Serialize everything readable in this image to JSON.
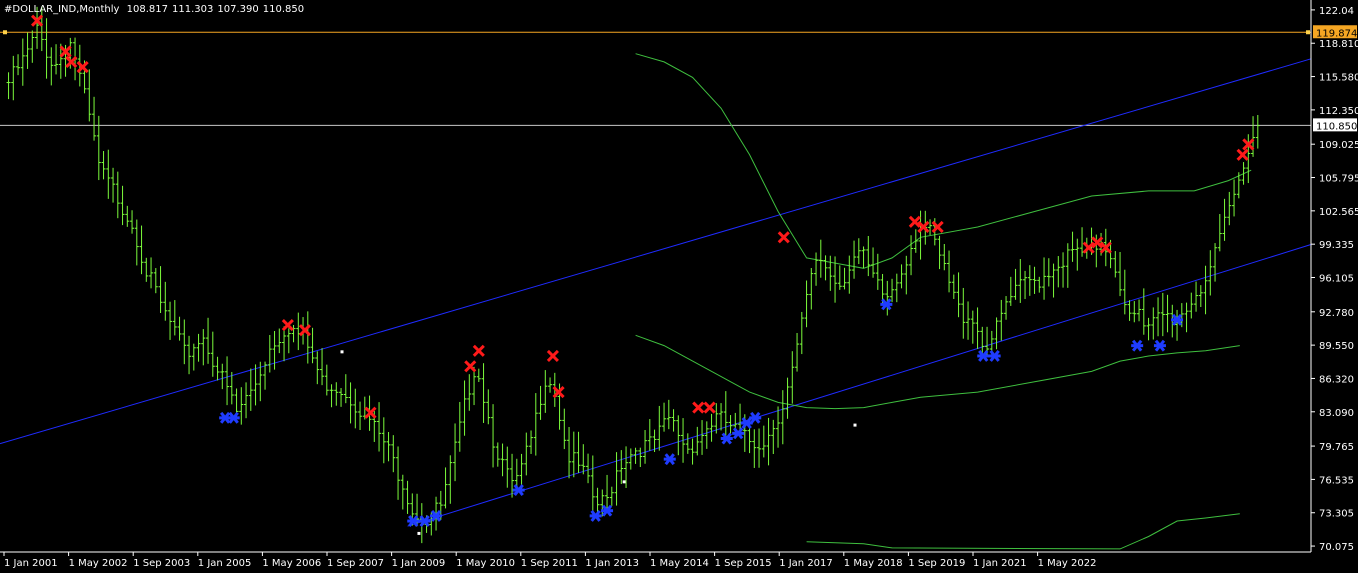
{
  "header": {
    "symbol_timeframe": "#DOLLAR_IND,Monthly",
    "open": "108.817",
    "high": "111.303",
    "low": "107.390",
    "close": "110.850"
  },
  "colors": {
    "background": "#000000",
    "bars": "#7cfc3c",
    "channel": "#1f2bff",
    "envelope": "#3fbf3f",
    "sell_marker": "#ff1a1a",
    "buy_marker": "#1f3cff",
    "axis_text": "#ffffff",
    "hline_max": "#f5a623",
    "hline_price": "#c8c8c8"
  },
  "chart_data": {
    "type": "bar",
    "title": "#DOLLAR_IND,Monthly",
    "y_ticks": [
      "122.04",
      "118.810",
      "115.580",
      "112.350",
      "109.025",
      "105.795",
      "102.565",
      "99.335",
      "96.105",
      "92.780",
      "89.550",
      "86.320",
      "83.090",
      "79.765",
      "76.535",
      "73.305",
      "70.075"
    ],
    "x_ticks": [
      "1 Jan 2001",
      "1 May 2002",
      "1 Sep 2003",
      "1 Jan 2005",
      "1 May 2006",
      "1 Sep 2007",
      "1 Jan 2009",
      "1 May 2010",
      "1 Sep 2011",
      "1 Jan 2013",
      "1 May 2014",
      "1 Sep 2015",
      "1 Jan 2017",
      "1 May 2018",
      "1 Sep 2019",
      "1 Jan 2021",
      "1 May 2022"
    ],
    "ylim": [
      69.5,
      123.0
    ],
    "xlim": [
      2000.85,
      2023.85
    ],
    "price_lines": [
      {
        "label": "119.874",
        "value": 119.874,
        "role": "max"
      },
      {
        "label": "110.850",
        "value": 110.85,
        "role": "current"
      }
    ],
    "monthly_close_anchors": [
      [
        2001.0,
        115.0
      ],
      [
        2001.3,
        117.5
      ],
      [
        2001.5,
        120.0
      ],
      [
        2001.8,
        116.5
      ],
      [
        2002.1,
        119.0
      ],
      [
        2002.4,
        112.0
      ],
      [
        2002.6,
        106.5
      ],
      [
        2002.9,
        104.0
      ],
      [
        2003.2,
        101.0
      ],
      [
        2003.4,
        97.0
      ],
      [
        2003.7,
        93.0
      ],
      [
        2003.9,
        91.0
      ],
      [
        2004.1,
        88.5
      ],
      [
        2004.4,
        90.5
      ],
      [
        2004.6,
        88.0
      ],
      [
        2004.9,
        84.5
      ],
      [
        2005.0,
        83.0
      ],
      [
        2005.3,
        85.5
      ],
      [
        2005.6,
        89.5
      ],
      [
        2005.9,
        91.5
      ],
      [
        2006.2,
        90.0
      ],
      [
        2006.5,
        86.0
      ],
      [
        2006.8,
        85.5
      ],
      [
        2007.0,
        84.5
      ],
      [
        2007.3,
        82.5
      ],
      [
        2007.6,
        80.0
      ],
      [
        2007.9,
        76.5
      ],
      [
        2008.1,
        73.5
      ],
      [
        2008.3,
        72.5
      ],
      [
        2008.6,
        74.0
      ],
      [
        2008.9,
        81.0
      ],
      [
        2009.1,
        86.0
      ],
      [
        2009.2,
        88.0
      ],
      [
        2009.5,
        80.5
      ],
      [
        2009.8,
        76.0
      ],
      [
        2009.95,
        76.5
      ],
      [
        2010.2,
        81.0
      ],
      [
        2010.4,
        86.5
      ],
      [
        2010.55,
        86.0
      ],
      [
        2010.8,
        79.0
      ],
      [
        2011.1,
        77.0
      ],
      [
        2011.3,
        74.0
      ],
      [
        2011.5,
        74.5
      ],
      [
        2011.7,
        78.0
      ],
      [
        2012.0,
        79.5
      ],
      [
        2012.3,
        80.0
      ],
      [
        2012.6,
        82.5
      ],
      [
        2012.9,
        79.5
      ],
      [
        2013.1,
        80.5
      ],
      [
        2013.4,
        82.5
      ],
      [
        2013.6,
        82.0
      ],
      [
        2013.9,
        80.5
      ],
      [
        2014.1,
        80.0
      ],
      [
        2014.3,
        80.5
      ],
      [
        2014.6,
        84.0
      ],
      [
        2014.8,
        88.0
      ],
      [
        2015.0,
        94.0
      ],
      [
        2015.2,
        98.5
      ],
      [
        2015.4,
        96.5
      ],
      [
        2015.6,
        95.5
      ],
      [
        2015.8,
        98.0
      ],
      [
        2015.95,
        98.5
      ],
      [
        2016.2,
        95.5
      ],
      [
        2016.4,
        94.0
      ],
      [
        2016.6,
        96.0
      ],
      [
        2016.85,
        99.5
      ],
      [
        2017.0,
        101.5
      ],
      [
        2017.2,
        100.0
      ],
      [
        2017.5,
        95.5
      ],
      [
        2017.7,
        92.5
      ],
      [
        2017.9,
        92.5
      ],
      [
        2018.1,
        89.5
      ],
      [
        2018.3,
        90.5
      ],
      [
        2018.5,
        93.5
      ],
      [
        2018.8,
        95.5
      ],
      [
        2019.1,
        96.0
      ],
      [
        2019.4,
        97.5
      ],
      [
        2019.7,
        98.5
      ],
      [
        2019.9,
        98.5
      ],
      [
        2020.1,
        98.5
      ],
      [
        2020.25,
        99.0
      ],
      [
        2020.4,
        97.5
      ],
      [
        2020.6,
        93.5
      ],
      [
        2020.8,
        93.0
      ],
      [
        2020.95,
        90.5
      ],
      [
        2021.2,
        92.5
      ],
      [
        2021.5,
        92.0
      ],
      [
        2021.7,
        93.5
      ],
      [
        2021.95,
        95.5
      ],
      [
        2022.2,
        98.5
      ],
      [
        2022.4,
        102.5
      ],
      [
        2022.6,
        105.5
      ],
      [
        2022.75,
        109.0
      ],
      [
        2022.9,
        110.85
      ]
    ],
    "channel_upper": [
      [
        2000.85,
        80.0
      ],
      [
        2023.85,
        117.3
      ]
    ],
    "channel_lower": [
      [
        2008.0,
        72.0
      ],
      [
        2023.85,
        99.3
      ]
    ],
    "envelope_upper": [
      [
        2012.0,
        117.8
      ],
      [
        2012.5,
        117.0
      ],
      [
        2013.0,
        115.5
      ],
      [
        2013.5,
        112.5
      ],
      [
        2014.0,
        108.0
      ],
      [
        2014.5,
        102.5
      ],
      [
        2015.0,
        98.0
      ],
      [
        2015.5,
        97.5
      ],
      [
        2016.0,
        97.0
      ],
      [
        2016.5,
        98.0
      ],
      [
        2017.0,
        100.0
      ],
      [
        2018.0,
        101.0
      ],
      [
        2019.0,
        102.5
      ],
      [
        2020.0,
        104.0
      ],
      [
        2021.0,
        104.5
      ],
      [
        2021.8,
        104.5
      ],
      [
        2022.4,
        105.5
      ],
      [
        2022.8,
        106.5
      ]
    ],
    "envelope_lower": [
      [
        2012.0,
        90.5
      ],
      [
        2012.5,
        89.5
      ],
      [
        2013.0,
        88.0
      ],
      [
        2013.5,
        86.5
      ],
      [
        2014.0,
        85.0
      ],
      [
        2014.5,
        84.0
      ],
      [
        2015.0,
        83.5
      ],
      [
        2015.5,
        83.4
      ],
      [
        2016.0,
        83.5
      ],
      [
        2016.5,
        84.0
      ],
      [
        2017.0,
        84.5
      ],
      [
        2018.0,
        85.0
      ],
      [
        2019.0,
        86.0
      ],
      [
        2020.0,
        87.0
      ],
      [
        2020.5,
        88.0
      ],
      [
        2021.0,
        88.5
      ],
      [
        2021.5,
        88.8
      ],
      [
        2022.0,
        89.0
      ],
      [
        2022.6,
        89.5
      ]
    ],
    "envelope_bottom": [
      [
        2015.0,
        70.5
      ],
      [
        2016.0,
        70.3
      ],
      [
        2016.5,
        69.9
      ],
      [
        2020.5,
        69.8
      ],
      [
        2021.0,
        71.0
      ],
      [
        2021.5,
        72.5
      ],
      [
        2022.0,
        72.8
      ],
      [
        2022.6,
        73.2
      ]
    ],
    "sell_signals": [
      [
        2001.5,
        121.0
      ],
      [
        2002.0,
        118.0
      ],
      [
        2002.1,
        117.0
      ],
      [
        2002.3,
        116.5
      ],
      [
        2005.9,
        91.5
      ],
      [
        2006.2,
        91.0
      ],
      [
        2007.35,
        83.0
      ],
      [
        2009.1,
        87.5
      ],
      [
        2009.25,
        89.0
      ],
      [
        2010.55,
        88.5
      ],
      [
        2010.65,
        85.0
      ],
      [
        2013.1,
        83.5
      ],
      [
        2013.3,
        83.5
      ],
      [
        2014.6,
        100.0
      ],
      [
        2016.9,
        101.5
      ],
      [
        2017.05,
        101.0
      ],
      [
        2017.3,
        101.0
      ],
      [
        2019.95,
        99.0
      ],
      [
        2020.1,
        99.5
      ],
      [
        2020.25,
        99.0
      ],
      [
        2022.65,
        108.0
      ],
      [
        2022.75,
        109.0
      ]
    ],
    "buy_signals": [
      [
        2004.8,
        82.5
      ],
      [
        2004.95,
        82.5
      ],
      [
        2008.1,
        72.5
      ],
      [
        2008.3,
        72.5
      ],
      [
        2008.5,
        73.0
      ],
      [
        2009.95,
        75.5
      ],
      [
        2011.3,
        73.0
      ],
      [
        2011.5,
        73.5
      ],
      [
        2012.6,
        78.5
      ],
      [
        2013.6,
        80.5
      ],
      [
        2013.8,
        81.0
      ],
      [
        2013.95,
        82.0
      ],
      [
        2014.1,
        82.5
      ],
      [
        2016.4,
        93.5
      ],
      [
        2018.1,
        88.5
      ],
      [
        2018.3,
        88.5
      ],
      [
        2020.8,
        89.5
      ],
      [
        2021.2,
        89.5
      ],
      [
        2021.5,
        92.0
      ]
    ],
    "anchor_points": [
      [
        2006.85,
        88.9
      ],
      [
        2008.2,
        71.3
      ],
      [
        2011.8,
        76.3
      ],
      [
        2015.85,
        81.8
      ]
    ]
  }
}
